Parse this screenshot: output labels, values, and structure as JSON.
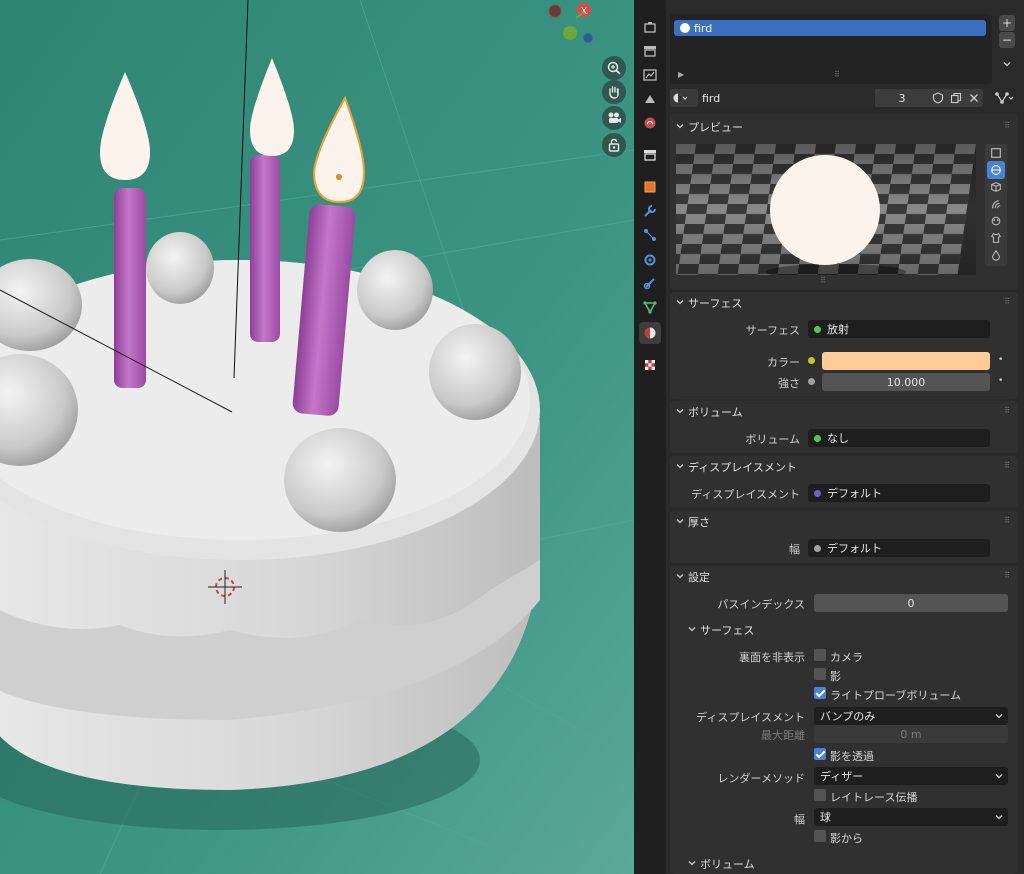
{
  "material_slots": {
    "selected": "fird",
    "add": "+",
    "remove": "−"
  },
  "material": {
    "name": "fird",
    "users": "3"
  },
  "panels": {
    "preview": "プレビュー",
    "surface": "サーフェス",
    "volume": "ボリューム",
    "displacement": "ディスプレイスメント",
    "thickness": "厚さ",
    "settings": "設定",
    "settings_surface": "サーフェス",
    "settings_volume": "ボリューム"
  },
  "surface": {
    "surface_label": "サーフェス",
    "surface_value": "放射",
    "color_label": "カラー",
    "color_value": "#ffcc99",
    "strength_label": "強さ",
    "strength_value": "10.000"
  },
  "volume": {
    "label": "ボリューム",
    "value": "なし"
  },
  "displacement": {
    "label": "ディスプレイスメント",
    "value": "デフォルト"
  },
  "thickness": {
    "label": "幅",
    "value": "デフォルト"
  },
  "settings": {
    "pass_index_label": "パスインデックス",
    "pass_index_value": "0",
    "backface_label": "裏面を非表示",
    "camera": "カメラ",
    "shadow": "影",
    "light_probe": "ライトプローブボリューム",
    "displacement_label": "ディスプレイスメント",
    "displacement_value": "バンプのみ",
    "max_distance_label": "最大距離",
    "max_distance_value": "0 m",
    "transparent_shadow": "影を透過",
    "render_method_label": "レンダーメソッド",
    "render_method_value": "ディザー",
    "raytrace": "レイトレース伝播",
    "thickness_label": "幅",
    "thickness_value": "球",
    "from_shadow": "影から"
  },
  "colors": {
    "accent": "#4a82d6",
    "selection": "#3d6fc0",
    "viewport_bg": "#3b8f7c",
    "candle": "#b564bc",
    "flame": "#fbf3ec",
    "active_outline": "#f0a030"
  }
}
